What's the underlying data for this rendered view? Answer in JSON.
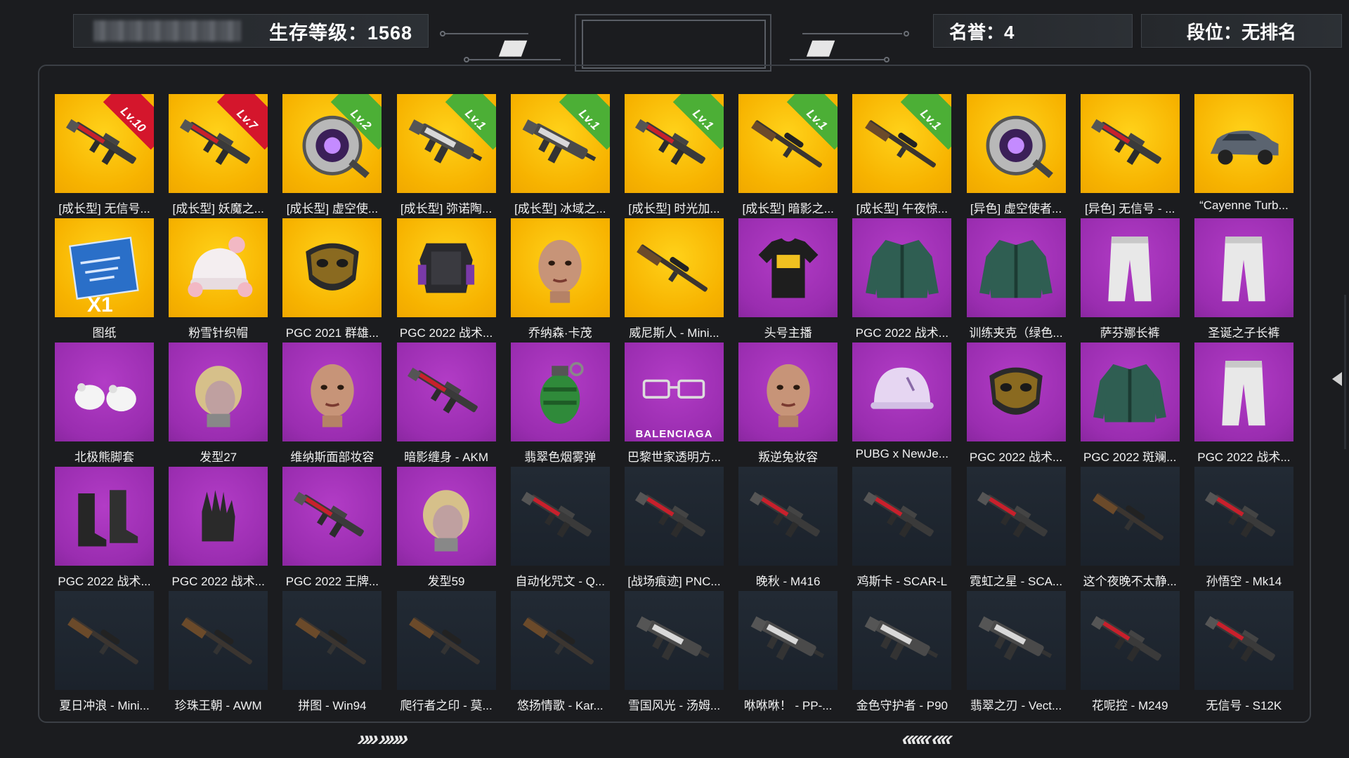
{
  "header": {
    "survival_level": "生存等级：1568",
    "honor": "名誉：4",
    "rank": "段位：无排名"
  },
  "colors": {
    "yellow": "#f7b300",
    "purple": "#9a2db0",
    "dark": "#1f2730",
    "badge_red": "#d4162c",
    "badge_green": "#4caf36"
  },
  "items": [
    {
      "label": "[成长型] 无信号...",
      "bg": "yellow",
      "icon": "rifle-icon",
      "badge": "Lv.10",
      "badge_color": "red"
    },
    {
      "label": "[成长型] 妖魔之...",
      "bg": "yellow",
      "icon": "rifle-icon",
      "badge": "Lv.7",
      "badge_color": "red"
    },
    {
      "label": "[成长型] 虚空使...",
      "bg": "yellow",
      "icon": "portal-ring-icon",
      "badge": "Lv.2",
      "badge_color": "green"
    },
    {
      "label": "[成长型] 弥诺陶...",
      "bg": "yellow",
      "icon": "smg-icon",
      "badge": "Lv.1",
      "badge_color": "green"
    },
    {
      "label": "[成长型] 冰域之...",
      "bg": "yellow",
      "icon": "smg-icon",
      "badge": "Lv.1",
      "badge_color": "green"
    },
    {
      "label": "[成长型] 时光加...",
      "bg": "yellow",
      "icon": "rifle-icon",
      "badge": "Lv.1",
      "badge_color": "green"
    },
    {
      "label": "[成长型] 暗影之...",
      "bg": "yellow",
      "icon": "sniper-icon",
      "badge": "Lv.1",
      "badge_color": "green"
    },
    {
      "label": "[成长型] 午夜惊...",
      "bg": "yellow",
      "icon": "sniper-icon",
      "badge": "Lv.1",
      "badge_color": "green"
    },
    {
      "label": "[异色] 虚空使者...",
      "bg": "yellow",
      "icon": "portal-ring-icon"
    },
    {
      "label": "[异色] 无信号 - ...",
      "bg": "yellow",
      "icon": "rifle-icon"
    },
    {
      "label": "“Cayenne Turb...",
      "bg": "yellow",
      "icon": "car-icon"
    },
    {
      "label": "图纸",
      "bg": "yellow",
      "icon": "blueprint-icon",
      "extra": "X1"
    },
    {
      "label": "粉雪针织帽",
      "bg": "yellow",
      "icon": "beanie-icon"
    },
    {
      "label": "PGC 2021 群雄...",
      "bg": "yellow",
      "icon": "mask-icon"
    },
    {
      "label": "PGC 2022 战术...",
      "bg": "yellow",
      "icon": "armor-icon"
    },
    {
      "label": "乔纳森·卡茂",
      "bg": "yellow",
      "icon": "face-icon"
    },
    {
      "label": "威尼斯人 - Mini...",
      "bg": "yellow",
      "icon": "sniper-icon"
    },
    {
      "label": "头号主播",
      "bg": "purple",
      "icon": "tshirt-icon"
    },
    {
      "label": "PGC 2022 战术...",
      "bg": "purple",
      "icon": "jacket-icon"
    },
    {
      "label": "训练夹克（绿色...",
      "bg": "purple",
      "icon": "jacket-icon"
    },
    {
      "label": "萨芬娜长裤",
      "bg": "purple",
      "icon": "pants-icon"
    },
    {
      "label": "圣诞之子长裤",
      "bg": "purple",
      "icon": "pants-icon"
    },
    {
      "label": "北极熊脚套",
      "bg": "purple",
      "icon": "paws-icon"
    },
    {
      "label": "发型27",
      "bg": "purple",
      "icon": "hair-icon"
    },
    {
      "label": "维纳斯面部妆容",
      "bg": "purple",
      "icon": "face-icon"
    },
    {
      "label": "暗影缠身 - AKM",
      "bg": "purple",
      "icon": "rifle-icon"
    },
    {
      "label": "翡翠色烟雾弹",
      "bg": "purple",
      "icon": "grenade-icon"
    },
    {
      "label": "巴黎世家透明方...",
      "bg": "purple",
      "icon": "glasses-icon",
      "extra": "BALENCIAGA"
    },
    {
      "label": "叛逆兔妆容",
      "bg": "purple",
      "icon": "face-icon"
    },
    {
      "label": "PUBG x NewJe...",
      "bg": "purple",
      "icon": "helmet-icon"
    },
    {
      "label": "PGC 2022 战术...",
      "bg": "purple",
      "icon": "mask-icon"
    },
    {
      "label": "PGC 2022 斑斓...",
      "bg": "purple",
      "icon": "jacket-icon"
    },
    {
      "label": "PGC 2022 战术...",
      "bg": "purple",
      "icon": "pants-icon"
    },
    {
      "label": "PGC 2022 战术...",
      "bg": "purple",
      "icon": "boots-icon"
    },
    {
      "label": "PGC 2022 战术...",
      "bg": "purple",
      "icon": "gloves-icon"
    },
    {
      "label": "PGC 2022 王牌...",
      "bg": "purple",
      "icon": "rifle-icon"
    },
    {
      "label": "发型59",
      "bg": "purple",
      "icon": "hair-icon"
    },
    {
      "label": "自动化咒文 - Q...",
      "bg": "dark",
      "icon": "rifle-icon"
    },
    {
      "label": "[战场痕迹] PNC...",
      "bg": "dark",
      "icon": "rifle-icon"
    },
    {
      "label": "晚秋 - M416",
      "bg": "dark",
      "icon": "rifle-icon"
    },
    {
      "label": "鸡斯卡 - SCAR-L",
      "bg": "dark",
      "icon": "rifle-icon"
    },
    {
      "label": "霓虹之星 - SCA...",
      "bg": "dark",
      "icon": "rifle-icon"
    },
    {
      "label": "这个夜晚不太静...",
      "bg": "dark",
      "icon": "sniper-icon"
    },
    {
      "label": "孙悟空 - Mk14",
      "bg": "dark",
      "icon": "rifle-icon"
    },
    {
      "label": "夏日冲浪 - Mini...",
      "bg": "dark",
      "icon": "sniper-icon"
    },
    {
      "label": "珍珠王朝 - AWM",
      "bg": "dark",
      "icon": "sniper-icon"
    },
    {
      "label": "拼图 - Win94",
      "bg": "dark",
      "icon": "sniper-icon"
    },
    {
      "label": "爬行者之印 - 莫...",
      "bg": "dark",
      "icon": "sniper-icon"
    },
    {
      "label": "悠扬情歌 - Kar...",
      "bg": "dark",
      "icon": "sniper-icon"
    },
    {
      "label": "雪国风光 - 汤姆...",
      "bg": "dark",
      "icon": "smg-icon"
    },
    {
      "label": "咻咻咻！ - PP-...",
      "bg": "dark",
      "icon": "smg-icon"
    },
    {
      "label": "金色守护者 - P90",
      "bg": "dark",
      "icon": "smg-icon"
    },
    {
      "label": "翡翠之刃 - Vect...",
      "bg": "dark",
      "icon": "smg-icon"
    },
    {
      "label": "花呢控 - M249",
      "bg": "dark",
      "icon": "rifle-icon"
    },
    {
      "label": "无信号 - S12K",
      "bg": "dark",
      "icon": "rifle-icon"
    }
  ]
}
